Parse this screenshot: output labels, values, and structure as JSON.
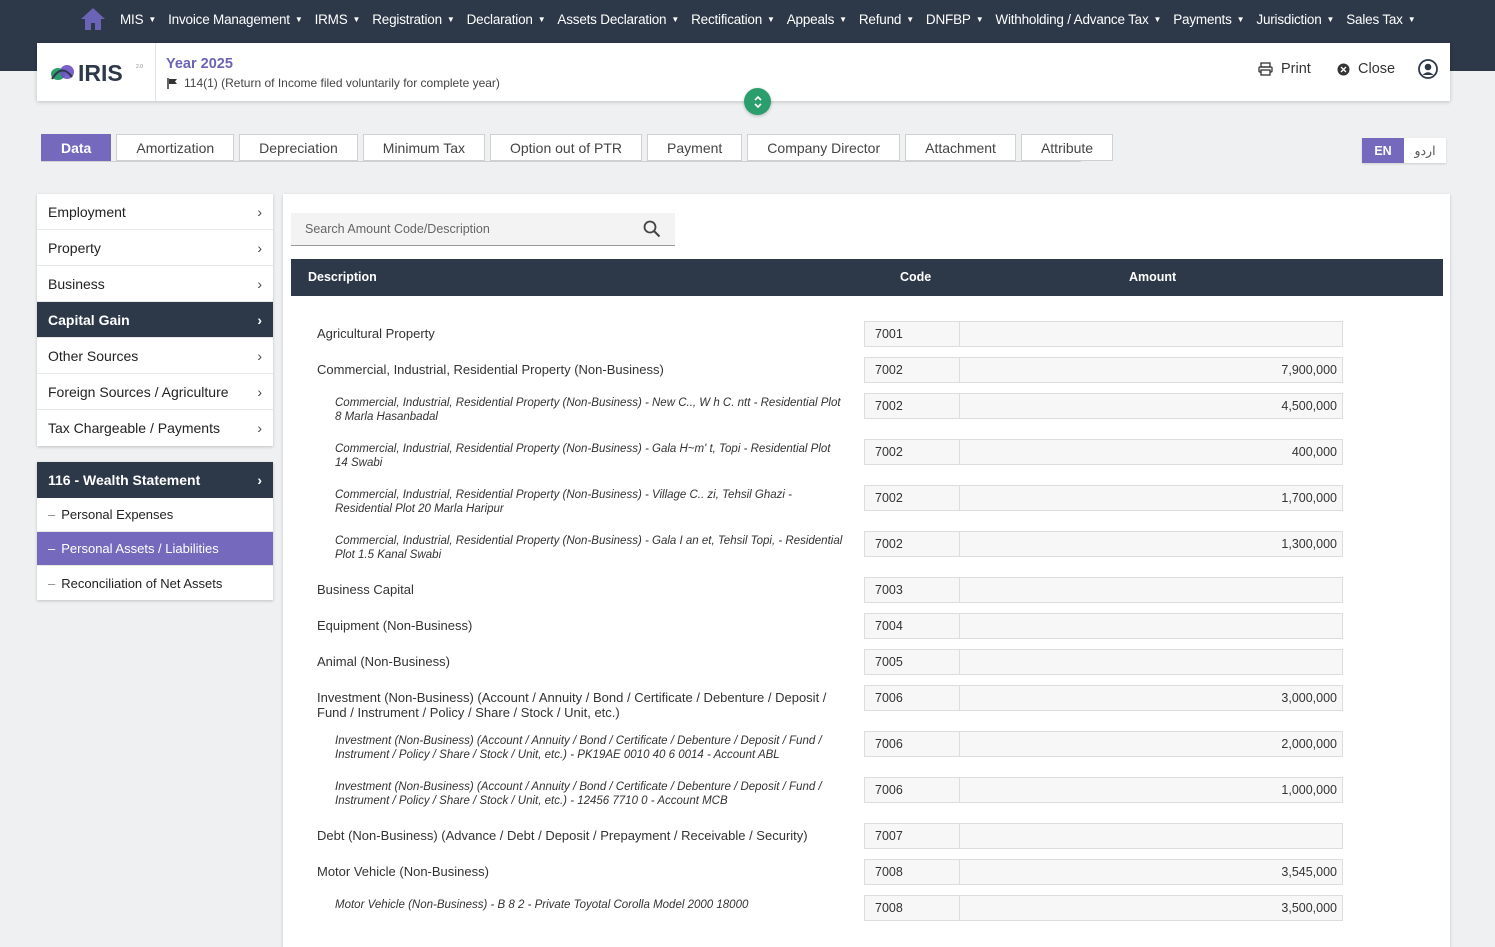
{
  "nav": {
    "items": [
      {
        "label": "MIS"
      },
      {
        "label": "Invoice Management"
      },
      {
        "label": "IRMS"
      },
      {
        "label": "Registration"
      },
      {
        "label": "Declaration"
      },
      {
        "label": "Assets Declaration"
      },
      {
        "label": "Rectification"
      },
      {
        "label": "Appeals"
      },
      {
        "label": "Refund"
      },
      {
        "label": "DNFBP"
      },
      {
        "label": "Withholding / Advance Tax"
      },
      {
        "label": "Payments"
      },
      {
        "label": "Jurisdiction"
      },
      {
        "label": "Sales Tax"
      }
    ]
  },
  "header": {
    "logo_text": "IRIS",
    "year": "Year 2025",
    "return_type": "114(1) (Return of Income filed voluntarily for complete year)",
    "print_label": "Print",
    "close_label": "Close"
  },
  "tabs": [
    {
      "label": "Data",
      "active": true
    },
    {
      "label": "Amortization"
    },
    {
      "label": "Depreciation"
    },
    {
      "label": "Minimum Tax"
    },
    {
      "label": "Option out of PTR"
    },
    {
      "label": "Payment"
    },
    {
      "label": "Company Director"
    },
    {
      "label": "Attachment"
    },
    {
      "label": "Attribute"
    }
  ],
  "language": {
    "en": "EN",
    "ur": "اردو"
  },
  "sidebar": {
    "items": [
      {
        "label": "Employment"
      },
      {
        "label": "Property"
      },
      {
        "label": "Business"
      },
      {
        "label": "Capital Gain",
        "active": true
      },
      {
        "label": "Other Sources"
      },
      {
        "label": "Foreign Sources / Agriculture"
      },
      {
        "label": "Tax Chargeable / Payments"
      }
    ]
  },
  "wealth": {
    "title": "116 - Wealth Statement",
    "items": [
      {
        "label": "Personal Expenses"
      },
      {
        "label": "Personal Assets / Liabilities",
        "active": true
      },
      {
        "label": "Reconciliation of Net Assets"
      }
    ]
  },
  "search": {
    "placeholder": "Search Amount Code/Description"
  },
  "table": {
    "headers": {
      "description": "Description",
      "code": "Code",
      "amount": "Amount"
    },
    "rows": [
      {
        "desc": "Agricultural Property",
        "code": "7001",
        "amount": "",
        "sub": false
      },
      {
        "desc": "Commercial, Industrial, Residential Property (Non-Business)",
        "code": "7002",
        "amount": "7,900,000",
        "sub": false
      },
      {
        "desc": "Commercial, Industrial, Residential Property (Non-Business) - New C.., W h C. ntt - Residential Plot 8 Marla Hasanbadal",
        "code": "7002",
        "amount": "4,500,000",
        "sub": true
      },
      {
        "desc": "Commercial, Industrial, Residential Property (Non-Business) - Gala H~m' t, Topi - Residential Plot 14 Swabi",
        "code": "7002",
        "amount": "400,000",
        "sub": true
      },
      {
        "desc": "Commercial, Industrial, Residential Property (Non-Business) - Village C.. zi, Tehsil Ghazi - Residential Plot 20 Marla Haripur",
        "code": "7002",
        "amount": "1,700,000",
        "sub": true
      },
      {
        "desc": "Commercial, Industrial, Residential Property (Non-Business) - Gala I an et, Tehsil Topi, - Residential Plot 1.5 Kanal Swabi",
        "code": "7002",
        "amount": "1,300,000",
        "sub": true
      },
      {
        "desc": "Business Capital",
        "code": "7003",
        "amount": "",
        "sub": false
      },
      {
        "desc": "Equipment (Non-Business)",
        "code": "7004",
        "amount": "",
        "sub": false
      },
      {
        "desc": "Animal (Non-Business)",
        "code": "7005",
        "amount": "",
        "sub": false
      },
      {
        "desc": "Investment (Non-Business) (Account / Annuity / Bond / Certificate / Debenture / Deposit / Fund / Instrument / Policy / Share / Stock / Unit, etc.)",
        "code": "7006",
        "amount": "3,000,000",
        "sub": false
      },
      {
        "desc": "Investment (Non-Business) (Account / Annuity / Bond / Certificate / Debenture / Deposit / Fund / Instrument / Policy / Share / Stock / Unit, etc.) - PK19AE 0010 40 6 0014 - Account ABL",
        "code": "7006",
        "amount": "2,000,000",
        "sub": true
      },
      {
        "desc": "Investment (Non-Business) (Account / Annuity / Bond / Certificate / Debenture / Deposit / Fund / Instrument / Policy / Share / Stock / Unit, etc.) - 12456 7710 0 - Account MCB",
        "code": "7006",
        "amount": "1,000,000",
        "sub": true
      },
      {
        "desc": "Debt (Non-Business) (Advance / Debt / Deposit / Prepayment / Receivable / Security)",
        "code": "7007",
        "amount": "",
        "sub": false
      },
      {
        "desc": "Motor Vehicle (Non-Business)",
        "code": "7008",
        "amount": "3,545,000",
        "sub": false
      },
      {
        "desc": "Motor Vehicle (Non-Business) - B 8 2 - Private Toyotal Corolla Model 2000 18000",
        "code": "7008",
        "amount": "3,500,000",
        "sub": true
      }
    ]
  },
  "colors": {
    "navbar": "#2d3848",
    "accent": "#7469bd",
    "toggle": "#2b9e6e",
    "year": "#6b63b5"
  }
}
